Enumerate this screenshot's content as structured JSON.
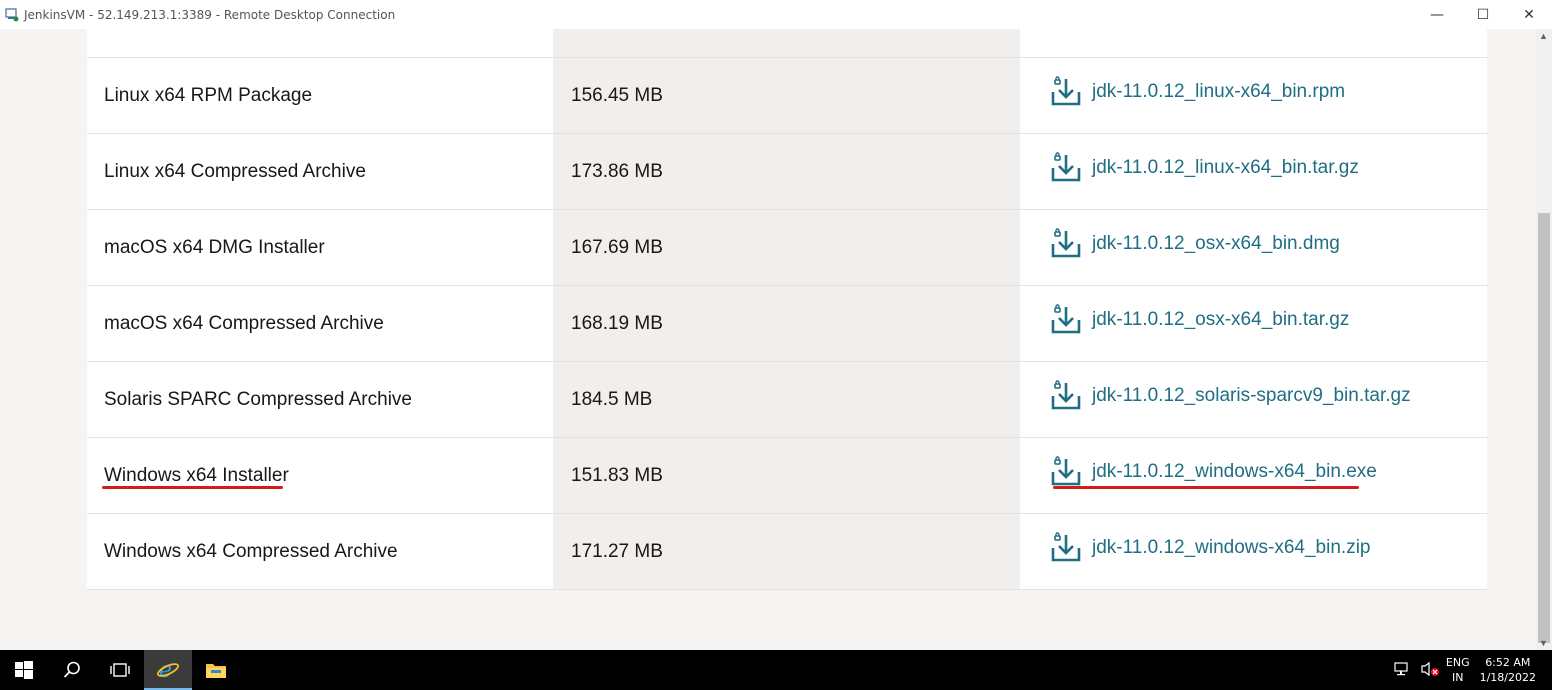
{
  "window": {
    "title": "JenkinsVM - 52.149.213.1:3389 - Remote Desktop Connection",
    "controls": {
      "minimize": "—",
      "maximize": "☐",
      "close": "✕"
    }
  },
  "downloads": [
    {
      "product": "Linux x64 RPM Package",
      "size": "156.45 MB",
      "file": "jdk-11.0.12_linux-x64_bin.rpm",
      "highlighted": false
    },
    {
      "product": "Linux x64 Compressed Archive",
      "size": "173.86 MB",
      "file": "jdk-11.0.12_linux-x64_bin.tar.gz",
      "highlighted": false
    },
    {
      "product": "macOS x64 DMG Installer",
      "size": "167.69 MB",
      "file": "jdk-11.0.12_osx-x64_bin.dmg",
      "highlighted": false
    },
    {
      "product": "macOS x64 Compressed Archive",
      "size": "168.19 MB",
      "file": "jdk-11.0.12_osx-x64_bin.tar.gz",
      "highlighted": false
    },
    {
      "product": "Solaris SPARC Compressed Archive",
      "size": "184.5 MB",
      "file": "jdk-11.0.12_solaris-sparcv9_bin.tar.gz",
      "highlighted": false
    },
    {
      "product": "Windows x64 Installer",
      "size": "151.83 MB",
      "file": "jdk-11.0.12_windows-x64_bin.exe",
      "highlighted": true
    },
    {
      "product": "Windows x64 Compressed Archive",
      "size": "171.27 MB",
      "file": "jdk-11.0.12_windows-x64_bin.zip",
      "highlighted": false
    }
  ],
  "colors": {
    "link": "#1f6e84",
    "highlight": "#d11d1d"
  },
  "taskbar": {
    "apps": [
      "start-icon",
      "search-icon",
      "task-view-icon",
      "internet-explorer-icon",
      "file-explorer-icon"
    ],
    "language": {
      "line1": "ENG",
      "line2": "IN"
    },
    "time": "6:52 AM",
    "date": "1/18/2022"
  }
}
